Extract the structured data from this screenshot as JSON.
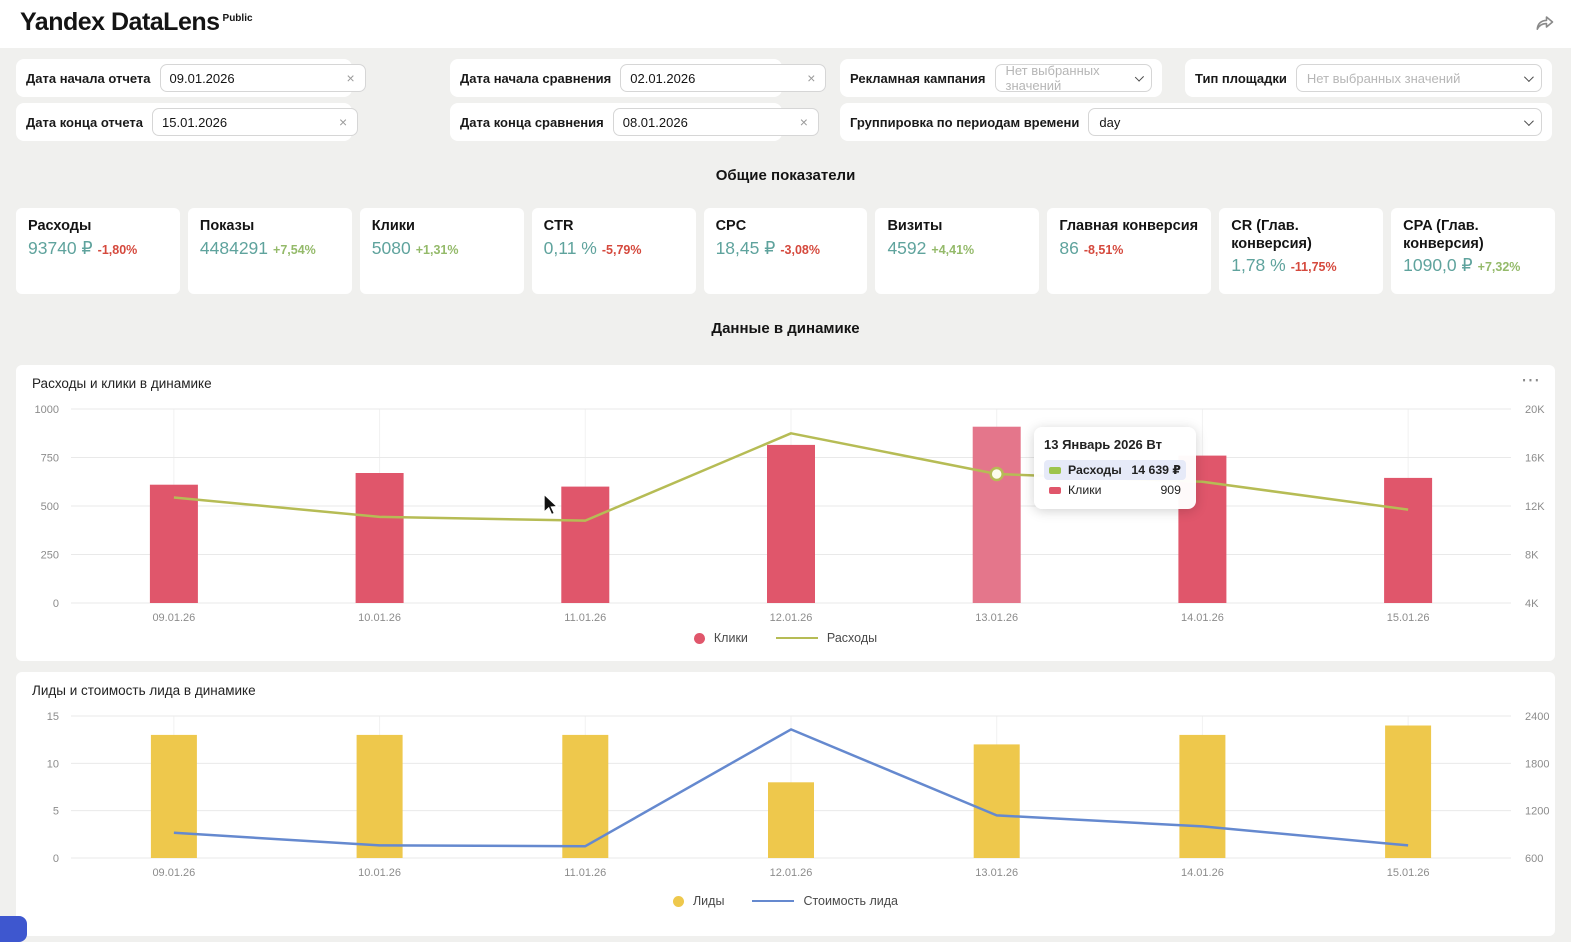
{
  "header": {
    "title": "Yandex DataLens",
    "badge": "Public"
  },
  "filters": {
    "report_start": {
      "label": "Дата начала отчета",
      "value": "09.01.2026"
    },
    "report_end": {
      "label": "Дата конца отчета",
      "value": "15.01.2026"
    },
    "compare_start": {
      "label": "Дата начала сравнения",
      "value": "02.01.2026"
    },
    "compare_end": {
      "label": "Дата конца сравнения",
      "value": "08.01.2026"
    },
    "campaign": {
      "label": "Рекламная кампания",
      "placeholder": "Нет выбранных значений"
    },
    "platform_type": {
      "label": "Тип площадки",
      "placeholder": "Нет выбранных значений"
    },
    "grouping": {
      "label": "Группировка по периодам времени",
      "value": "day"
    }
  },
  "sections": {
    "kpi_title": "Общие показатели",
    "dynamics_title": "Данные в динамике"
  },
  "kpi_cards": [
    {
      "label": "Расходы",
      "value": "93740 ₽",
      "delta": "-1,80%",
      "trend": "down"
    },
    {
      "label": "Показы",
      "value": "4484291",
      "delta": "+7,54%",
      "trend": "up"
    },
    {
      "label": "Клики",
      "value": "5080",
      "delta": "+1,31%",
      "trend": "up"
    },
    {
      "label": "CTR",
      "value": "0,11 %",
      "delta": "-5,79%",
      "trend": "down"
    },
    {
      "label": "CPC",
      "value": "18,45 ₽",
      "delta": "-3,08%",
      "trend": "down"
    },
    {
      "label": "Визиты",
      "value": "4592",
      "delta": "+4,41%",
      "trend": "up"
    },
    {
      "label": "Главная конверсия",
      "value": "86",
      "delta": "-8,51%",
      "trend": "down"
    },
    {
      "label": "CR (Глав. конверсия)",
      "value": "1,78 %",
      "delta": "-11,75%",
      "trend": "down"
    },
    {
      "label": "CPA (Глав. конверсия)",
      "value": "1090,0 ₽",
      "delta": "+7,32%",
      "trend": "up"
    }
  ],
  "chart_data": [
    {
      "type": "bar",
      "title": "Расходы и клики в динамике",
      "categories": [
        "09.01.26",
        "10.01.26",
        "11.01.26",
        "12.01.26",
        "13.01.26",
        "14.01.26",
        "15.01.26"
      ],
      "series": [
        {
          "name": "Клики",
          "type": "bar",
          "axis": "left",
          "color": "#e0566b",
          "values": [
            610,
            670,
            600,
            815,
            909,
            760,
            645
          ]
        },
        {
          "name": "Расходы",
          "type": "line",
          "axis": "right",
          "color": "#b6bc55",
          "values": [
            12700,
            11100,
            10800,
            18000,
            14639,
            14000,
            11700
          ]
        }
      ],
      "left_axis": {
        "min": 0,
        "max": 1000,
        "ticks": [
          0,
          250,
          500,
          750,
          1000
        ],
        "labels": [
          "0",
          "250",
          "500",
          "750",
          "1000"
        ]
      },
      "right_axis": {
        "min": 4000,
        "max": 20000,
        "ticks": [
          4000,
          8000,
          12000,
          16000,
          20000
        ],
        "labels": [
          "4K",
          "8K",
          "12K",
          "16K",
          "20K"
        ]
      },
      "highlight_index": 4,
      "highlight_color": "#e4768b",
      "legend": [
        {
          "label": "Клики",
          "type": "dot",
          "color": "#e0566b"
        },
        {
          "label": "Расходы",
          "type": "line",
          "color": "#b6bc55"
        }
      ],
      "grid": true,
      "legend_position": "bottom-center"
    },
    {
      "type": "bar",
      "title": "Лиды и стоимость лида в динамике",
      "categories": [
        "09.01.26",
        "10.01.26",
        "11.01.26",
        "12.01.26",
        "13.01.26",
        "14.01.26",
        "15.01.26"
      ],
      "series": [
        {
          "name": "Лиды",
          "type": "bar",
          "axis": "left",
          "color": "#eec84c",
          "values": [
            13,
            13,
            13,
            8,
            12,
            13,
            14
          ]
        },
        {
          "name": "Стоимость лида",
          "type": "line",
          "axis": "right",
          "color": "#6589cf",
          "values": [
            920,
            760,
            750,
            2230,
            1140,
            1000,
            760
          ]
        }
      ],
      "left_axis": {
        "min": 0,
        "max": 15,
        "ticks": [
          0,
          5,
          10,
          15
        ],
        "labels": [
          "0",
          "5",
          "10",
          "15"
        ]
      },
      "right_axis": {
        "min": 600,
        "max": 2400,
        "ticks": [
          600,
          1200,
          1800,
          2400
        ],
        "labels": [
          "600",
          "1200",
          "1800",
          "2400"
        ]
      },
      "highlight_index": null,
      "legend": [
        {
          "label": "Лиды",
          "type": "dot",
          "color": "#eec84c"
        },
        {
          "label": "Стоимость лида",
          "type": "line",
          "color": "#6589cf"
        }
      ],
      "grid": true,
      "legend_position": "bottom-center"
    }
  ],
  "tooltip": {
    "title": "13 Январь 2026 Вт",
    "rows": [
      {
        "swatch": "#9dc44d",
        "label": "Расходы",
        "value": "14 639 ₽",
        "highlight": true
      },
      {
        "swatch": "#e0566b",
        "label": "Клики",
        "value": "909",
        "highlight": false
      }
    ]
  },
  "colors": {
    "kpi_value": "#5fa39d",
    "delta_up": "#94ba6a",
    "delta_down": "#d5493d",
    "page_bg": "#f0f0ee",
    "card_bg": "#ffffff"
  }
}
